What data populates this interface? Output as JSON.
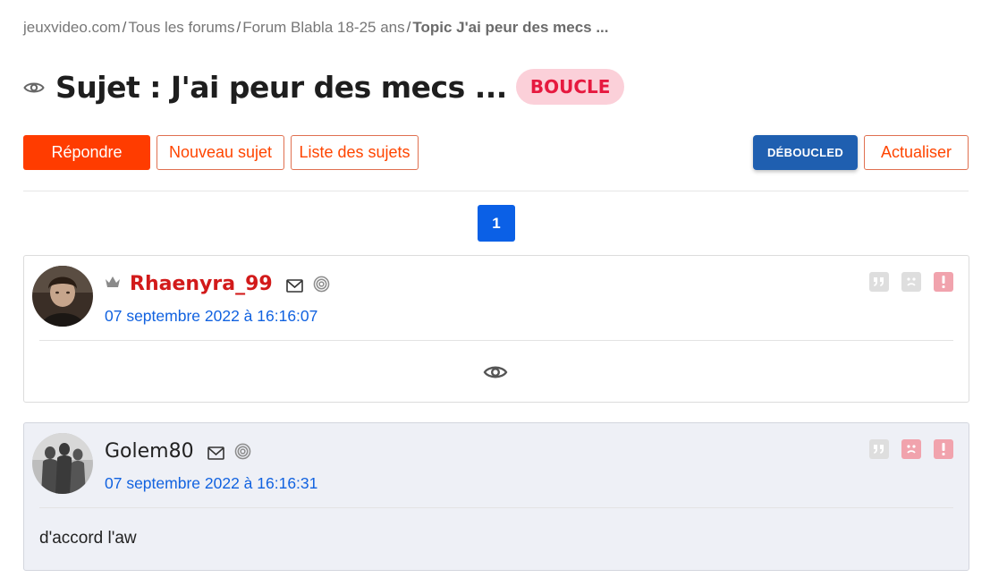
{
  "breadcrumb": {
    "items": [
      "jeuxvideo.com",
      "Tous les forums",
      "Forum Blabla 18-25 ans"
    ],
    "current": "Topic J'ai peur des mecs ...",
    "separator": "/"
  },
  "topic": {
    "title": "Sujet : J'ai peur des mecs ...",
    "badge": "BOUCLE"
  },
  "toolbar": {
    "reply_label": "Répondre",
    "new_topic_label": "Nouveau sujet",
    "topic_list_label": "Liste des sujets",
    "deboucled_label": "DÉBOUCLED",
    "refresh_label": "Actualiser"
  },
  "pagination": {
    "current_page": "1"
  },
  "posts": [
    {
      "author": "Rhaenyra_99",
      "date": "07 septembre 2022 à 16:16:07",
      "content": "",
      "hidden": true
    },
    {
      "author": "Golem80",
      "date": "07 septembre 2022 à 16:16:31",
      "content": "d'accord l'aw",
      "hidden": false
    }
  ],
  "colors": {
    "brand": "#ff3c00",
    "link": "#1162e0",
    "badge_bg": "#fbd0d9",
    "badge_text": "#e6193f",
    "deboucled": "#1f5fb0",
    "author_red": "#d21a1a"
  },
  "icons": [
    "eye-icon",
    "crown-icon",
    "mail-icon",
    "spiral-icon",
    "quote-icon",
    "sad-face-icon",
    "alert-icon"
  ]
}
